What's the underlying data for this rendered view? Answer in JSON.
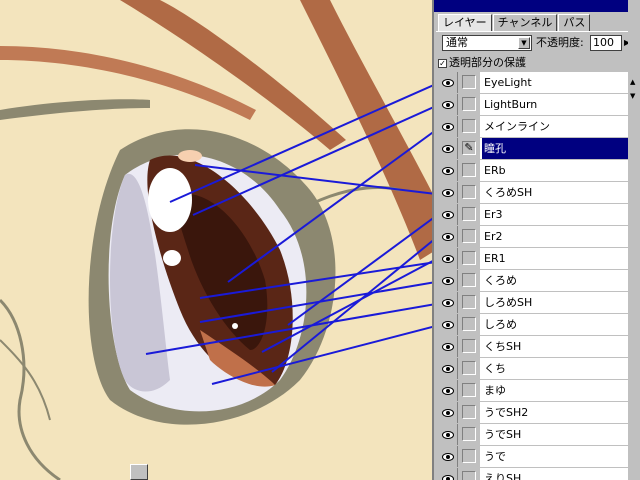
{
  "canvas": {
    "description_colors": {
      "background": "#f3e4bd",
      "eye_white": "#ecebf4",
      "iris": "#5a2616",
      "outline": "#8c8870",
      "annotation_line": "#1a1ad8"
    }
  },
  "layers_panel": {
    "tabs": [
      {
        "label": "レイヤー"
      },
      {
        "label": "チャンネル"
      },
      {
        "label": "パス"
      }
    ],
    "blend_mode": "通常",
    "opacity_label": "不透明度:",
    "opacity_value": "100",
    "opacity_unit": "%",
    "preserve_transparency_label": "透明部分の保護",
    "preserve_transparency_checked": true,
    "layers": [
      {
        "name": "EyeLight",
        "visible": true,
        "selected": false
      },
      {
        "name": "LightBurn",
        "visible": true,
        "selected": false
      },
      {
        "name": "メインライン",
        "visible": true,
        "selected": false
      },
      {
        "name": "瞳孔",
        "visible": true,
        "selected": true
      },
      {
        "name": "ERb",
        "visible": true,
        "selected": false
      },
      {
        "name": "くろめSH",
        "visible": true,
        "selected": false
      },
      {
        "name": "Er3",
        "visible": true,
        "selected": false
      },
      {
        "name": "Er2",
        "visible": true,
        "selected": false
      },
      {
        "name": "ER1",
        "visible": true,
        "selected": false
      },
      {
        "name": "くろめ",
        "visible": true,
        "selected": false
      },
      {
        "name": "しろめSH",
        "visible": true,
        "selected": false
      },
      {
        "name": "しろめ",
        "visible": true,
        "selected": false
      },
      {
        "name": "くちSH",
        "visible": true,
        "selected": false
      },
      {
        "name": "くち",
        "visible": true,
        "selected": false
      },
      {
        "name": "まゆ",
        "visible": true,
        "selected": false
      },
      {
        "name": "うでSH2",
        "visible": true,
        "selected": false
      },
      {
        "name": "うでSH",
        "visible": true,
        "selected": false
      },
      {
        "name": "うで",
        "visible": true,
        "selected": false
      },
      {
        "name": "えりSH",
        "visible": true,
        "selected": false
      }
    ]
  }
}
